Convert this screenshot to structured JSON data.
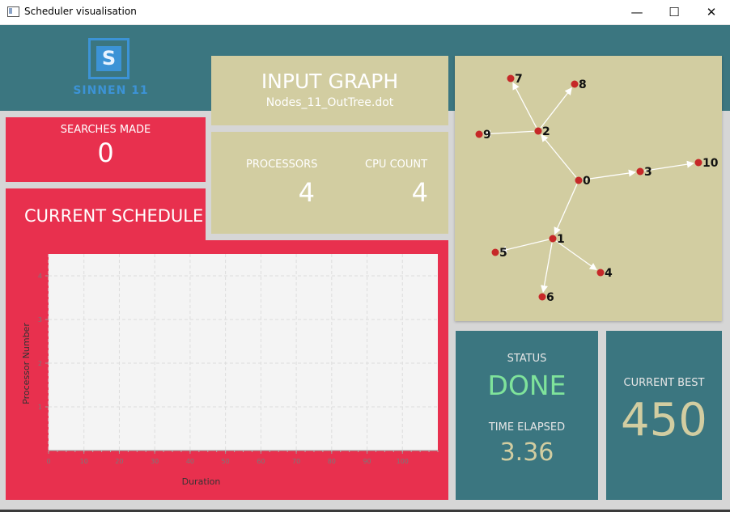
{
  "window": {
    "title": "Scheduler visualisation",
    "minimize": "—",
    "maximize": "☐",
    "close": "✕"
  },
  "logo": {
    "letter": "S",
    "text": "SINNEN 11"
  },
  "searches": {
    "label": "SEARCHES MADE",
    "value": "0"
  },
  "input_graph": {
    "title": "INPUT GRAPH",
    "filename": "Nodes_11_OutTree.dot"
  },
  "processors": {
    "label": "PROCESSORS",
    "value": "4"
  },
  "cpu": {
    "label": "CPU COUNT",
    "value": "4"
  },
  "schedule": {
    "title": "CURRENT SCHEDULE"
  },
  "status": {
    "label": "STATUS",
    "value": "DONE"
  },
  "time": {
    "label": "TIME ELAPSED",
    "value": "3.36"
  },
  "best": {
    "label": "CURRENT BEST",
    "value": "450"
  },
  "colors": {
    "red": "#e8304e",
    "tan": "#d2cda1",
    "teal": "#3b7680",
    "done_green": "#7fe39b",
    "logo_blue": "#3c93d6"
  },
  "chart_data": {
    "type": "bar",
    "xlabel": "Duration",
    "ylabel": "Processor Number",
    "xlim": [
      0,
      110
    ],
    "ylim": [
      0,
      4.5
    ],
    "xticks": [
      0,
      10,
      20,
      30,
      40,
      50,
      60,
      70,
      80,
      90,
      100
    ],
    "yticks": [
      1,
      2,
      3,
      4
    ],
    "grid": true,
    "series": []
  },
  "graph": {
    "nodes": [
      "0",
      "1",
      "2",
      "3",
      "4",
      "5",
      "6",
      "7",
      "8",
      "9",
      "10"
    ],
    "edges": [
      [
        "0",
        "1"
      ],
      [
        "0",
        "2"
      ],
      [
        "0",
        "3"
      ],
      [
        "3",
        "10"
      ],
      [
        "2",
        "7"
      ],
      [
        "2",
        "8"
      ],
      [
        "2",
        "9"
      ],
      [
        "1",
        "4"
      ],
      [
        "1",
        "5"
      ],
      [
        "1",
        "6"
      ]
    ]
  }
}
